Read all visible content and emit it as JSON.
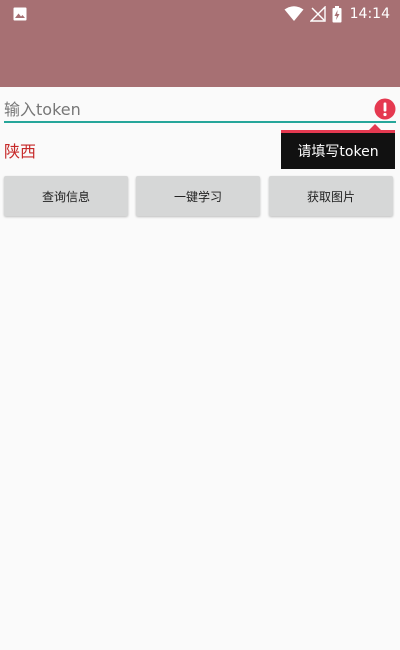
{
  "status_bar": {
    "time": "14:14",
    "color": "#a77073",
    "icons": [
      "gallery-icon",
      "wifi-icon",
      "no-signal-icon",
      "battery-charging-icon"
    ]
  },
  "token_input": {
    "value": "",
    "placeholder": "输入token",
    "error_text": "请填写token",
    "accent_color": "#26a69a",
    "error_color": "#e53950"
  },
  "region": {
    "label": "陕西",
    "color": "#c62828"
  },
  "buttons": {
    "query_info": "查询信息",
    "one_click_study": "一键学习",
    "get_image": "获取图片"
  }
}
